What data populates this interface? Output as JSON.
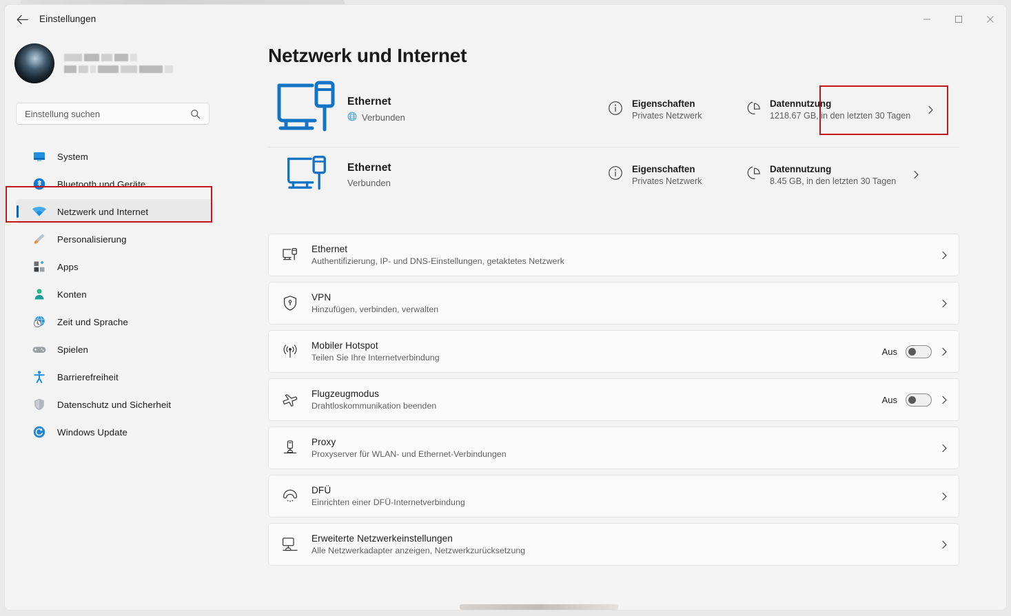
{
  "window": {
    "app_title": "Einstellungen",
    "back_icon": "back-arrow-icon",
    "minimize_label": "—",
    "maximize_label": "□",
    "close_label": "✕"
  },
  "sidebar": {
    "search": {
      "placeholder": "Einstellung suchen",
      "icon": "search-icon"
    },
    "items": [
      {
        "label": "System",
        "icon": "monitor-icon",
        "selected": false
      },
      {
        "label": "Bluetooth und Geräte",
        "icon": "bluetooth-icon",
        "selected": false
      },
      {
        "label": "Netzwerk und Internet",
        "icon": "wifi-icon",
        "selected": true
      },
      {
        "label": "Personalisierung",
        "icon": "paintbrush-icon",
        "selected": false
      },
      {
        "label": "Apps",
        "icon": "apps-grid-icon",
        "selected": false
      },
      {
        "label": "Konten",
        "icon": "person-icon",
        "selected": false
      },
      {
        "label": "Zeit und Sprache",
        "icon": "clock-globe-icon",
        "selected": false
      },
      {
        "label": "Spielen",
        "icon": "gamepad-icon",
        "selected": false
      },
      {
        "label": "Barrierefreiheit",
        "icon": "accessibility-icon",
        "selected": false
      },
      {
        "label": "Datenschutz und Sicherheit",
        "icon": "shield-icon",
        "selected": false
      },
      {
        "label": "Windows Update",
        "icon": "refresh-icon",
        "selected": false
      }
    ]
  },
  "main": {
    "page_title": "Netzwerk und Internet",
    "connections": [
      {
        "name": "Ethernet",
        "status": "Verbunden",
        "status_icon": "globe-icon",
        "icon": "ethernet-large-icon",
        "properties": {
          "title": "Eigenschaften",
          "subtitle": "Privates Netzwerk",
          "icon": "info-circle-icon"
        },
        "data_usage": {
          "title": "Datennutzung",
          "subtitle": "1218.67 GB, in den letzten 30 Tagen",
          "icon": "pie-chart-icon"
        }
      },
      {
        "name": "Ethernet",
        "status": "Verbunden",
        "status_icon": "",
        "icon": "ethernet-small-icon",
        "properties": {
          "title": "Eigenschaften",
          "subtitle": "Privates Netzwerk",
          "icon": "info-circle-icon"
        },
        "data_usage": {
          "title": "Datennutzung",
          "subtitle": "8.45 GB, in den letzten 30 Tagen",
          "icon": "pie-chart-icon"
        }
      }
    ],
    "settings_rows": [
      {
        "title": "Ethernet",
        "subtitle": "Authentifizierung, IP- und DNS-Einstellungen, getaktetes Netzwerk",
        "icon": "ethernet-icon",
        "toggle": null
      },
      {
        "title": "VPN",
        "subtitle": "Hinzufügen, verbinden, verwalten",
        "icon": "vpn-shield-icon",
        "toggle": null
      },
      {
        "title": "Mobiler Hotspot",
        "subtitle": "Teilen Sie Ihre Internetverbindung",
        "icon": "hotspot-icon",
        "toggle": {
          "label": "Aus",
          "on": false
        }
      },
      {
        "title": "Flugzeugmodus",
        "subtitle": "Drahtloskommunikation beenden",
        "icon": "airplane-icon",
        "toggle": {
          "label": "Aus",
          "on": false
        }
      },
      {
        "title": "Proxy",
        "subtitle": "Proxyserver für WLAN- und Ethernet-Verbindungen",
        "icon": "proxy-server-icon",
        "toggle": null
      },
      {
        "title": "DFÜ",
        "subtitle": "Einrichten einer DFÜ-Internetverbindung",
        "icon": "dialup-phone-icon",
        "toggle": null
      },
      {
        "title": "Erweiterte Netzwerkeinstellungen",
        "subtitle": "Alle Netzwerkadapter anzeigen, Netzwerkzurücksetzung",
        "icon": "advanced-network-icon",
        "toggle": null
      }
    ]
  },
  "colors": {
    "accent_blue": "#0067c0",
    "ethernet_blue": "#1473c4",
    "annotation_red": "#c5161c",
    "window_bg": "#f3f3f3",
    "card_bg": "#fbfbfb",
    "text_primary": "#1b1b1b",
    "text_secondary": "#5e5e5e"
  }
}
